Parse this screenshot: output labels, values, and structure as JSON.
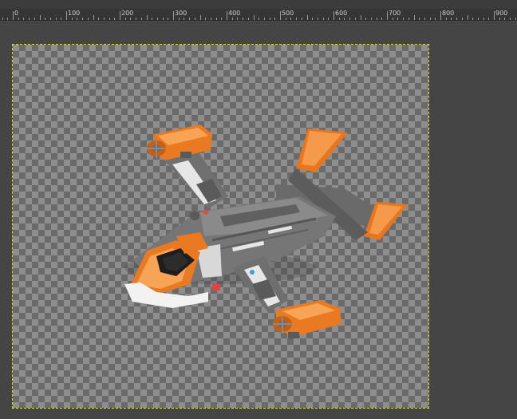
{
  "ruler": {
    "labels": [
      "0",
      "100",
      "200",
      "300",
      "400",
      "500",
      "600",
      "700",
      "800",
      "900"
    ]
  },
  "canvas": {
    "image_subject": "orange-gray-tiltrotor-aircraft-model",
    "transparency_pattern": "checkerboard"
  },
  "colors": {
    "workspace_bg": "#454545",
    "ruler_bg": "#3c3c3c",
    "checker_light": "#8e8e8e",
    "checker_dark": "#6a6a6a",
    "selection_border": "#d8d838",
    "aircraft_orange": "#f07a20",
    "aircraft_gray": "#6e6e6e"
  }
}
